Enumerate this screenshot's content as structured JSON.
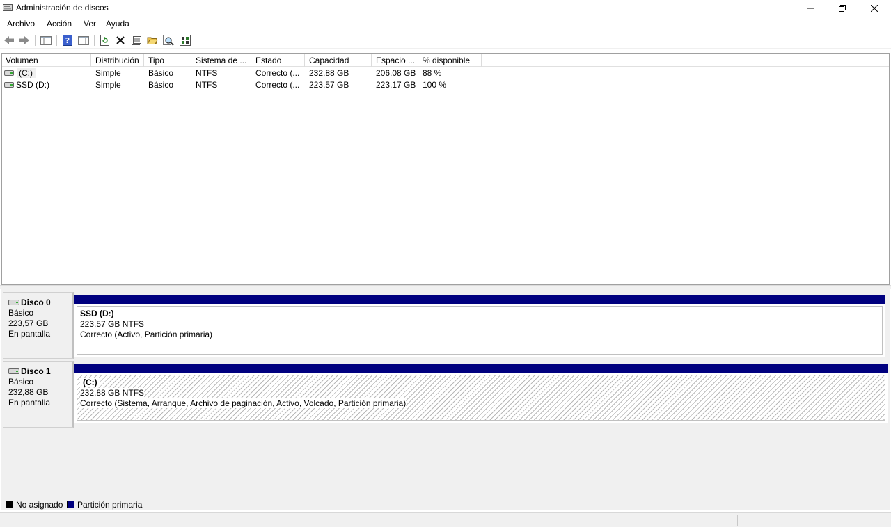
{
  "window": {
    "title": "Administración de discos"
  },
  "menu": [
    "Archivo",
    "Acción",
    "Ver",
    "Ayuda"
  ],
  "toolbar": {
    "icons": [
      "back-arrow-icon",
      "forward-arrow-icon",
      "show-hide-tree-icon",
      "help-icon",
      "properties-pane-icon",
      "refresh-icon",
      "delete-icon",
      "properties-icon",
      "open-folder-icon",
      "search-icon",
      "export-list-icon"
    ]
  },
  "volume_table": {
    "columns": [
      "Volumen",
      "Distribución",
      "Tipo",
      "Sistema de ...",
      "Estado",
      "Capacidad",
      "Espacio ...",
      "% disponible"
    ],
    "rows": [
      [
        "(C:)",
        "Simple",
        "Básico",
        "NTFS",
        "Correcto (...",
        "232,88 GB",
        "206,08 GB",
        "88 %"
      ],
      [
        "SSD (D:)",
        "Simple",
        "Básico",
        "NTFS",
        "Correcto (...",
        "223,57 GB",
        "223,17 GB",
        "100 %"
      ]
    ]
  },
  "disks": [
    {
      "name": "Disco 0",
      "type": "Básico",
      "size": "223,57 GB",
      "status": "En pantalla",
      "partition": {
        "name": "SSD  (D:)",
        "size_fs": "223,57 GB NTFS",
        "state": "Correcto (Activo, Partición primaria)"
      }
    },
    {
      "name": "Disco 1",
      "type": "Básico",
      "size": "232,88 GB",
      "status": "En pantalla",
      "partition": {
        "name": "(C:)",
        "size_fs": "232,88 GB NTFS",
        "state": "Correcto (Sistema, Arranque, Archivo de paginación, Activo, Volcado, Partición primaria)"
      }
    }
  ],
  "legend": [
    {
      "label": "No asignado",
      "color": "#000000"
    },
    {
      "label": "Partición primaria",
      "color": "#00007f"
    }
  ]
}
